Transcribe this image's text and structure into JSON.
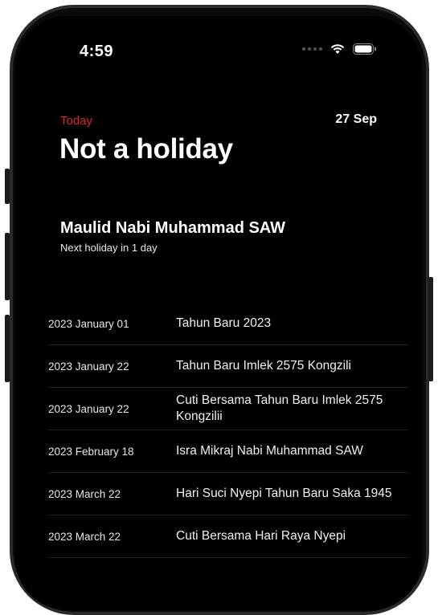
{
  "status_bar": {
    "time": "4:59"
  },
  "header": {
    "today_label": "Today",
    "date": "27 Sep",
    "status_title": "Not a holiday"
  },
  "next_holiday": {
    "name": "Maulid Nabi Muhammad SAW",
    "subtitle": "Next holiday in 1 day"
  },
  "holidays": [
    {
      "date": "2023 January 01",
      "name": "Tahun Baru 2023"
    },
    {
      "date": "2023 January 22",
      "name": "Tahun Baru Imlek 2575 Kongzili"
    },
    {
      "date": "2023 January 22",
      "name": "Cuti Bersama Tahun Baru Imlek 2575 Kongzilii"
    },
    {
      "date": "2023 February 18",
      "name": "Isra Mikraj Nabi Muhammad SAW"
    },
    {
      "date": "2023 March 22",
      "name": "Hari Suci Nyepi Tahun Baru Saka 1945"
    },
    {
      "date": "2023 March 22",
      "name": "Cuti Bersama Hari Raya Nyepi"
    }
  ],
  "colors": {
    "accent": "#e0242d",
    "background": "#000000"
  }
}
